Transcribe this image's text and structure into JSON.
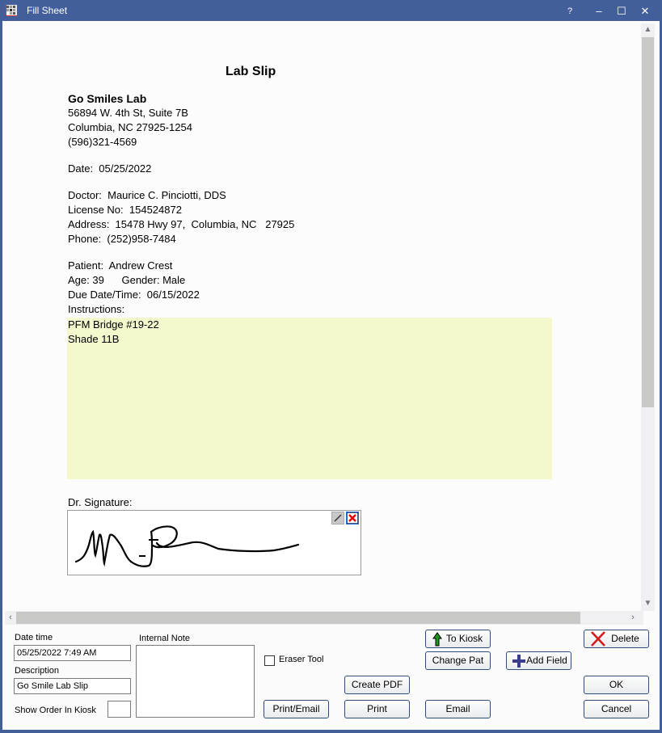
{
  "window": {
    "title": "Fill Sheet",
    "help_label": "?",
    "minimize_label": "–",
    "maximize_label": "☐",
    "close_label": "✕",
    "icon": "grid-app-icon"
  },
  "sheet": {
    "title": "Lab Slip",
    "lab": {
      "name": "Go Smiles Lab",
      "address1": "56894 W. 4th St, Suite 7B",
      "address2": "Columbia, NC 27925-1254",
      "phone": "(596)321-4569"
    },
    "date_line": "Date:  05/25/2022",
    "doctor_line": "Doctor:  Maurice C. Pinciotti, DDS",
    "license_line": "License No:  154524872",
    "address_line": "Address:  15478 Hwy 97,  Columbia, NC   27925",
    "phone_line": "Phone:  (252)958-7484",
    "patient_line": "Patient:  Andrew Crest",
    "age_gender_line": "Age: 39      Gender: Male",
    "due_line": "Due Date/Time:  06/15/2022",
    "instructions_label": "Instructions:",
    "instructions_lines": [
      "PFM Bridge #19-22",
      "Shade 11B"
    ],
    "signature_label": "Dr. Signature:",
    "instructions_bg": "#f5f7cc"
  },
  "bottom": {
    "date_time_label": "Date time",
    "date_time_value": "05/25/2022 7:49 AM",
    "description_label": "Description",
    "description_value": "Go Smile Lab Slip",
    "show_order_label": "Show Order In Kiosk",
    "show_order_value": "",
    "internal_note_label": "Internal Note",
    "internal_note_value": "",
    "eraser_label": "Eraser Tool",
    "buttons": {
      "to_kiosk": "To Kiosk",
      "change_pat": "Change Pat",
      "add_field": "Add Field",
      "delete": "Delete",
      "create_pdf": "Create PDF",
      "print_email": "Print/Email",
      "print": "Print",
      "email": "Email",
      "ok": "OK",
      "cancel": "Cancel"
    }
  },
  "colors": {
    "titlebar": "#425f9c",
    "button_border": "#2f4d77",
    "kiosk_arrow": "#1a9a1a",
    "delete_x": "#d21c1c",
    "add_plus": "#3c3c8c"
  }
}
